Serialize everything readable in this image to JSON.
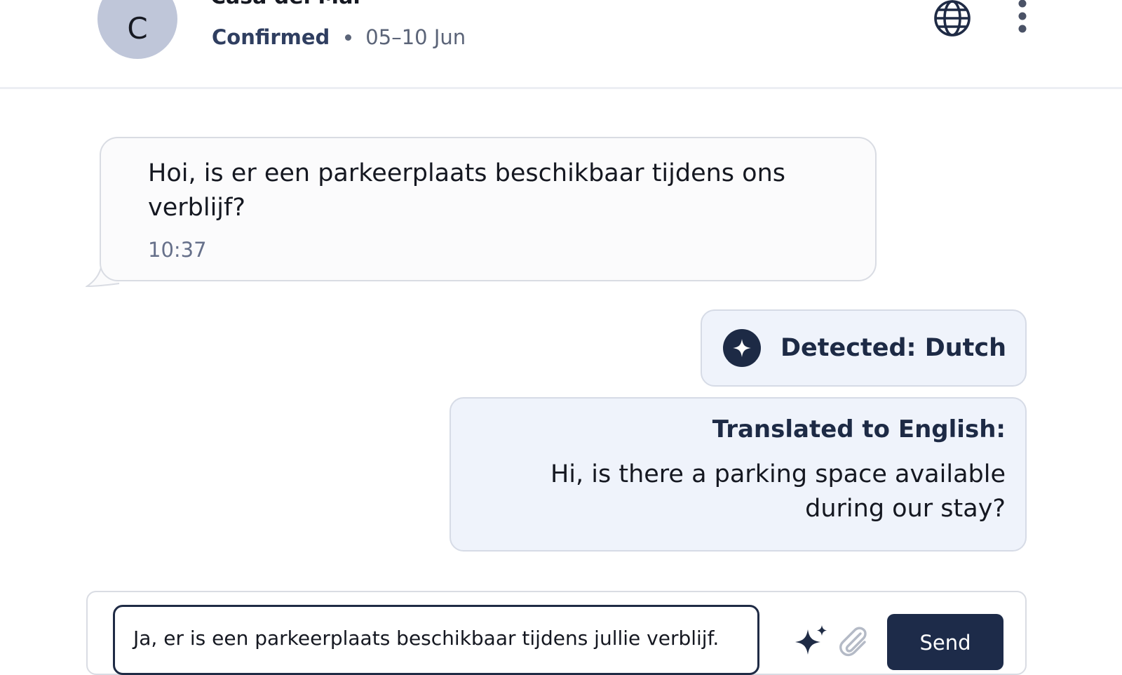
{
  "header": {
    "avatar_letter": "C",
    "guest_name": "Casa del Mar",
    "status": "Confirmed",
    "dates": "05–10 Jun",
    "globe_icon": "globe-icon",
    "more_icon": "more-vertical-icon"
  },
  "messages": {
    "incoming": {
      "text": "Hoi, is er een parkeerplaats beschikbaar tijdens ons verblijf?",
      "time": "10:37"
    },
    "detection": {
      "icon": "sparkle-icon",
      "label": "Detected: Dutch"
    },
    "translation": {
      "label": "Translated to English:",
      "text": "Hi, is there a parking space available during our stay?"
    }
  },
  "composer": {
    "input_value": "Ja, er is een parkeerplaats beschikbaar tijdens jullie verblijf.",
    "ai_icon": "sparkles-icon",
    "attach_icon": "paperclip-icon",
    "send_label": "Send"
  },
  "colors": {
    "accent": "#1d2b49",
    "avatar_bg": "#bfc6d9",
    "card_bg": "#eff3fb",
    "muted_text": "#5b6478"
  }
}
